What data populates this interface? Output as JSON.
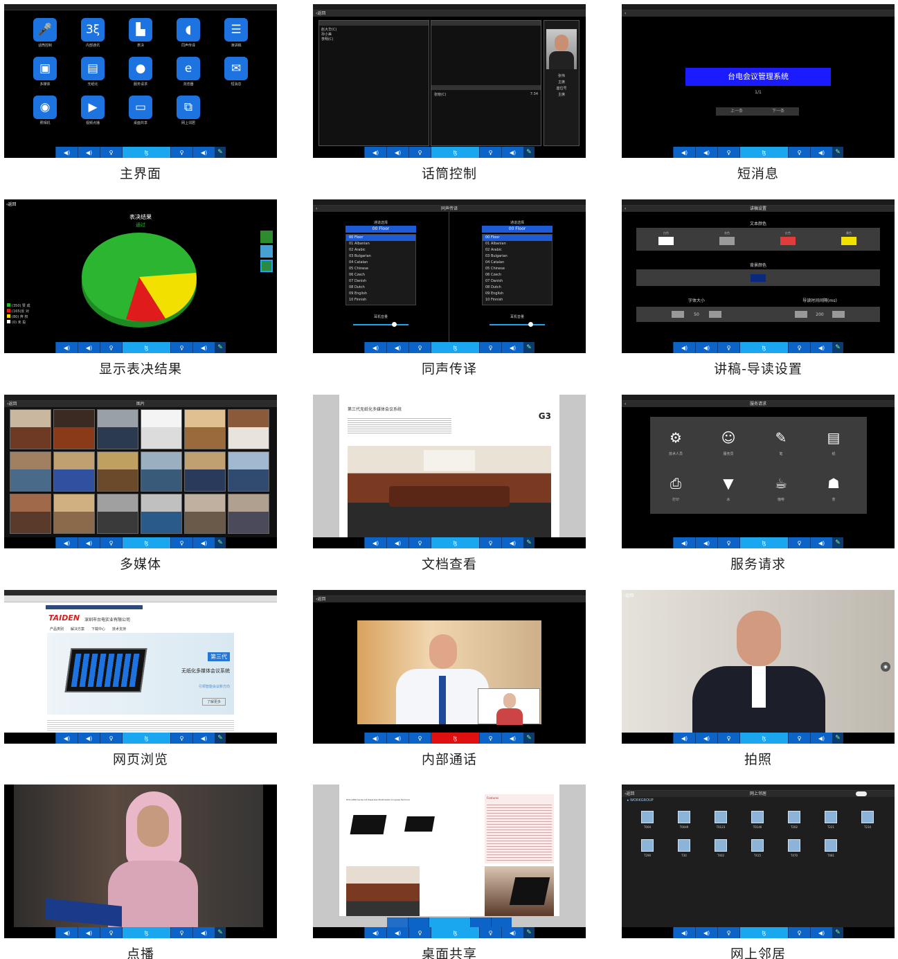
{
  "panels": {
    "main": {
      "caption": "主界面",
      "apps": [
        {
          "label": "话筒控制",
          "icon": "microphone-icon",
          "glyph": "🎤"
        },
        {
          "label": "内部通讯",
          "icon": "intercom-icon",
          "glyph": "3ξ"
        },
        {
          "label": "表决",
          "icon": "bar-chart-icon",
          "glyph": "▙"
        },
        {
          "label": "同声传译",
          "icon": "ear-icon",
          "glyph": "◖"
        },
        {
          "label": "演讲稿",
          "icon": "document-icon",
          "glyph": "☰"
        },
        {
          "label": "多媒体",
          "icon": "film-icon",
          "glyph": "▣"
        },
        {
          "label": "无纸化",
          "icon": "paper-icon",
          "glyph": "▤"
        },
        {
          "label": "服务请求",
          "icon": "user-icon",
          "glyph": "●"
        },
        {
          "label": "浏览器",
          "icon": "browser-icon",
          "glyph": "e"
        },
        {
          "label": "短消息",
          "icon": "message-icon",
          "glyph": "✉"
        },
        {
          "label": "照相机",
          "icon": "camera-icon",
          "glyph": "◉"
        },
        {
          "label": "视频点播",
          "icon": "play-icon",
          "glyph": "▶"
        },
        {
          "label": "桌面共享",
          "icon": "desktop-share-icon",
          "glyph": "▭"
        },
        {
          "label": "网上邻居",
          "icon": "network-icon",
          "glyph": "⧉"
        }
      ]
    },
    "mic": {
      "caption": "话筒控制",
      "back": "返回",
      "list": [
        "赵大华(C)",
        "孙小美",
        "李明(C)"
      ],
      "queue_item": "张晓(C)",
      "queue_time": "7:34",
      "speaker_labels": [
        "张伟",
        "主席",
        "座位号",
        "主席"
      ]
    },
    "sms": {
      "caption": "短消息",
      "banner": "台电会议管理系统",
      "page": "1/1",
      "prev": "上一条",
      "next": "下一条"
    },
    "vote": {
      "caption": "显示表决结果",
      "back": "返回",
      "title": "表决结果",
      "status": "通过",
      "legend": [
        {
          "text": "(350) 赞 成",
          "color": "#2bb530"
        },
        {
          "text": "(165)反 对",
          "color": "#e01b1b"
        },
        {
          "text": "(80) 弃 权",
          "color": "#f2e100"
        },
        {
          "text": "(0) 未 投",
          "color": "#ffffff"
        }
      ]
    },
    "interp": {
      "caption": "同声传译",
      "title": "同声传译",
      "channel_label": "通道选择",
      "selected": "00 Floor",
      "channels": [
        "00 Floor",
        "01 Albanian",
        "02 Arabic",
        "03 Bulgarian",
        "04 Catalan",
        "05 Chinese",
        "06 Czech",
        "07 Danish",
        "08 Dutch",
        "09 English",
        "10 Finnish"
      ],
      "volume_label": "耳机音量"
    },
    "speech": {
      "caption": "讲稿-导读设置",
      "title": "讲稿设置",
      "text_color_label": "文本颜色",
      "swatches": [
        {
          "name": "白色",
          "color": "#ffffff"
        },
        {
          "name": "灰色",
          "color": "#9a9a9a"
        },
        {
          "name": "红色",
          "color": "#e23b3b"
        },
        {
          "name": "黄色",
          "color": "#f2e100"
        }
      ],
      "bg_color_label": "背景颜色",
      "bg_color": "#0a2a80",
      "font_size_label": "字体大小",
      "font_size": "50",
      "interval_label": "导读时间间隔(ms)",
      "interval": "200"
    },
    "media": {
      "caption": "多媒体",
      "back": "返回",
      "title": "图片"
    },
    "doc": {
      "caption": "文档查看",
      "heading": "第三代无纸化多媒体会议系统",
      "tag": "G3"
    },
    "service": {
      "caption": "服务请求",
      "title": "服务请求",
      "items": [
        {
          "label": "技术人员",
          "icon": "technician-icon",
          "glyph": "⚙"
        },
        {
          "label": "服务员",
          "icon": "waiter-icon",
          "glyph": "☺"
        },
        {
          "label": "笔",
          "icon": "pen-icon",
          "glyph": "✎"
        },
        {
          "label": "纸",
          "icon": "paper-sheet-icon",
          "glyph": "▤"
        },
        {
          "label": "打印",
          "icon": "printer-icon",
          "glyph": "⎙"
        },
        {
          "label": "水",
          "icon": "water-cup-icon",
          "glyph": "▼"
        },
        {
          "label": "咖啡",
          "icon": "coffee-icon",
          "glyph": "☕"
        },
        {
          "label": "茶",
          "icon": "tea-icon",
          "glyph": "☗"
        }
      ]
    },
    "web": {
      "caption": "网页浏览",
      "brand": "TAIDEN",
      "company": "深圳市台电实业有限公司",
      "nav": [
        "产品类别",
        "解决方案",
        "下载中心",
        "技术支持"
      ],
      "badge": "第三代",
      "headline": "无纸化多媒体会议系统",
      "sub": "引领智能会议新方向",
      "more": "了解更多"
    },
    "intercom": {
      "caption": "内部通话",
      "back": "返回"
    },
    "photo": {
      "caption": "拍照",
      "back": "返回"
    },
    "vod": {
      "caption": "点播"
    },
    "share": {
      "caption": "桌面共享",
      "doc_title": "HCS-4366 Series G3 Paperless Multimedia Congress Terminal",
      "features": "Features"
    },
    "network": {
      "caption": "网上邻居",
      "back": "返回",
      "title": "网上邻居",
      "group": "WORKGROUP",
      "computers": [
        "T004",
        "T0049",
        "T0123",
        "T0146",
        "T202",
        "T221",
        "T234",
        "T290",
        "T30",
        "T402",
        "T415",
        "T470",
        "T481"
      ]
    }
  }
}
